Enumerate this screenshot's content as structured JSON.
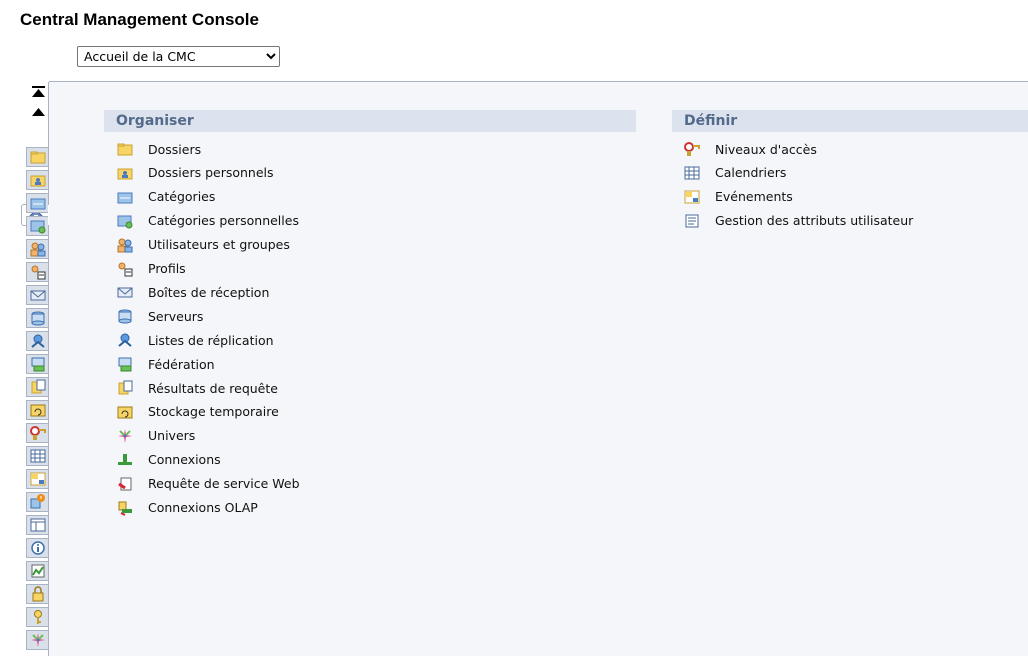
{
  "app": {
    "title": "Central Management Console"
  },
  "navigation": {
    "selected": "Accueil de la CMC",
    "options": [
      "Accueil de la CMC"
    ]
  },
  "left_tabs": [
    "folder-icon",
    "personal-folder-icon",
    "category-icon",
    "personal-category-icon",
    "users-groups-icon",
    "profiles-icon",
    "inbox-icon",
    "servers-icon",
    "replication-icon",
    "federation-icon",
    "query-results-icon",
    "temp-storage-icon",
    "access-levels-icon",
    "calendar-icon",
    "events-icon",
    "alert-icon",
    "table-icon",
    "info-icon",
    "monitoring-icon",
    "lock-icon",
    "key-icon",
    "universe-icon"
  ],
  "organiser": {
    "title": "Organiser",
    "items": [
      {
        "label": "Dossiers",
        "icon": "folder-icon"
      },
      {
        "label": "Dossiers personnels",
        "icon": "personal-folder-icon"
      },
      {
        "label": "Catégories",
        "icon": "category-icon"
      },
      {
        "label": "Catégories personnelles",
        "icon": "personal-category-icon"
      },
      {
        "label": "Utilisateurs et groupes",
        "icon": "users-groups-icon"
      },
      {
        "label": "Profils",
        "icon": "profiles-icon"
      },
      {
        "label": "Boîtes de réception",
        "icon": "inbox-icon"
      },
      {
        "label": "Serveurs",
        "icon": "servers-icon"
      },
      {
        "label": "Listes de réplication",
        "icon": "replication-icon"
      },
      {
        "label": "Fédération",
        "icon": "federation-icon"
      },
      {
        "label": "Résultats de requête",
        "icon": "query-results-icon"
      },
      {
        "label": "Stockage temporaire",
        "icon": "temp-storage-icon"
      },
      {
        "label": "Univers",
        "icon": "universe-icon"
      },
      {
        "label": "Connexions",
        "icon": "connections-icon"
      },
      {
        "label": "Requête de service Web",
        "icon": "web-service-icon"
      },
      {
        "label": "Connexions OLAP",
        "icon": "olap-connections-icon"
      }
    ]
  },
  "definir": {
    "title": "Définir",
    "items": [
      {
        "label": "Niveaux d'accès",
        "icon": "access-levels-icon"
      },
      {
        "label": "Calendriers",
        "icon": "calendar-icon"
      },
      {
        "label": "Evénements",
        "icon": "events-icon"
      },
      {
        "label": "Gestion des attributs utilisateur",
        "icon": "user-attributes-icon"
      }
    ]
  }
}
